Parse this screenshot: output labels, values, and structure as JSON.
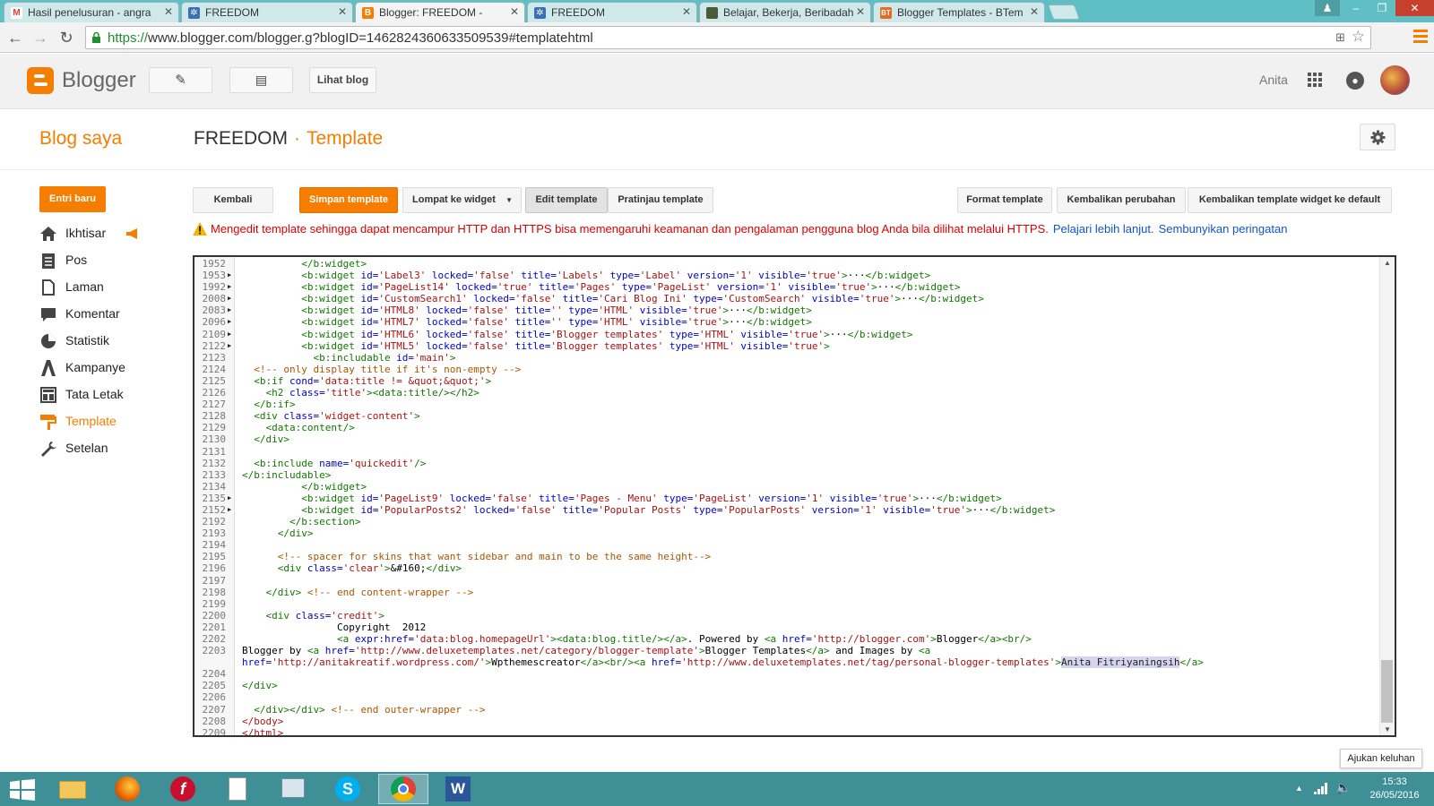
{
  "browser": {
    "tabs": [
      {
        "title": "Hasil penelusuran - angra",
        "icon": "gmail-icon",
        "active": false
      },
      {
        "title": "FREEDOM",
        "icon": "blog-favicon",
        "active": false
      },
      {
        "title": "Blogger: FREEDOM -",
        "icon": "blogger-icon",
        "active": true
      },
      {
        "title": "FREEDOM",
        "icon": "blog-favicon",
        "active": false
      },
      {
        "title": "Belajar, Bekerja, Beribadah",
        "icon": "page-icon",
        "active": false
      },
      {
        "title": "Blogger Templates - BTem",
        "icon": "btemplates-icon",
        "active": false
      }
    ],
    "url_secure": "https://",
    "url_rest": "www.blogger.com/blogger.g?blogID=1462824360633509539#templatehtml"
  },
  "header": {
    "brand": "Blogger",
    "view_blog": "Lihat blog",
    "username": "Anita"
  },
  "page": {
    "my_blogs": "Blog saya",
    "blog_name": "FREEDOM",
    "separator": "·",
    "section": "Template"
  },
  "sidebar": {
    "new_post": "Entri baru",
    "items": [
      {
        "label": "Ikhtisar",
        "icon": "home-icon"
      },
      {
        "label": "Pos",
        "icon": "posts-icon"
      },
      {
        "label": "Laman",
        "icon": "pages-icon"
      },
      {
        "label": "Komentar",
        "icon": "comment-icon"
      },
      {
        "label": "Statistik",
        "icon": "stats-icon"
      },
      {
        "label": "Kampanye",
        "icon": "campaign-icon"
      },
      {
        "label": "Tata Letak",
        "icon": "layout-icon"
      },
      {
        "label": "Template",
        "icon": "template-icon",
        "active": true
      },
      {
        "label": "Setelan",
        "icon": "wrench-icon"
      }
    ]
  },
  "toolbar": {
    "back": "Kembali",
    "save": "Simpan template",
    "jump": "Lompat ke widget",
    "edit": "Edit template",
    "preview": "Pratinjau template",
    "format": "Format template",
    "revert": "Kembalikan perubahan",
    "revert_widgets": "Kembalikan template widget ke default"
  },
  "warning": {
    "text": "Mengedit template sehingga dapat mencampur HTTP dan HTTPS bisa memengaruhi keamanan dan pengalaman pengguna blog Anda bila dilihat melalui HTTPS.",
    "learn_more": "Pelajari lebih lanjut.",
    "hide": "Sembunyikan peringatan"
  },
  "code_lines": [
    {
      "n": "1952",
      "a": false,
      "t": [
        [
          "tag",
          "          </b:widget>"
        ]
      ]
    },
    {
      "n": "1953",
      "a": true,
      "t": [
        [
          "tag",
          "          <b:widget "
        ],
        [
          "attr",
          "id="
        ],
        [
          "str",
          "'Label3'"
        ],
        [
          "attr",
          " locked="
        ],
        [
          "str",
          "'false'"
        ],
        [
          "attr",
          " title="
        ],
        [
          "str",
          "'Labels'"
        ],
        [
          "attr",
          " type="
        ],
        [
          "str",
          "'Label'"
        ],
        [
          "attr",
          " version="
        ],
        [
          "str",
          "'1'"
        ],
        [
          "attr",
          " visible="
        ],
        [
          "str",
          "'true'"
        ],
        [
          "tag",
          ">"
        ],
        [
          "plain",
          "···"
        ],
        [
          "tag",
          "</b:widget>"
        ]
      ]
    },
    {
      "n": "1992",
      "a": true,
      "t": [
        [
          "tag",
          "          <b:widget "
        ],
        [
          "attr",
          "id="
        ],
        [
          "str",
          "'PageList14'"
        ],
        [
          "attr",
          " locked="
        ],
        [
          "str",
          "'true'"
        ],
        [
          "attr",
          " title="
        ],
        [
          "str",
          "'Pages'"
        ],
        [
          "attr",
          " type="
        ],
        [
          "str",
          "'PageList'"
        ],
        [
          "attr",
          " version="
        ],
        [
          "str",
          "'1'"
        ],
        [
          "attr",
          " visible="
        ],
        [
          "str",
          "'true'"
        ],
        [
          "tag",
          ">"
        ],
        [
          "plain",
          "···"
        ],
        [
          "tag",
          "</b:widget>"
        ]
      ]
    },
    {
      "n": "2008",
      "a": true,
      "t": [
        [
          "tag",
          "          <b:widget "
        ],
        [
          "attr",
          "id="
        ],
        [
          "str",
          "'CustomSearch1'"
        ],
        [
          "attr",
          " locked="
        ],
        [
          "str",
          "'false'"
        ],
        [
          "attr",
          " title="
        ],
        [
          "str",
          "'Cari Blog Ini'"
        ],
        [
          "attr",
          " type="
        ],
        [
          "str",
          "'CustomSearch'"
        ],
        [
          "attr",
          " visible="
        ],
        [
          "str",
          "'true'"
        ],
        [
          "tag",
          ">"
        ],
        [
          "plain",
          "···"
        ],
        [
          "tag",
          "</b:widget>"
        ]
      ]
    },
    {
      "n": "2083",
      "a": true,
      "t": [
        [
          "tag",
          "          <b:widget "
        ],
        [
          "attr",
          "id="
        ],
        [
          "str",
          "'HTML8'"
        ],
        [
          "attr",
          " locked="
        ],
        [
          "str",
          "'false'"
        ],
        [
          "attr",
          " title="
        ],
        [
          "str",
          "''"
        ],
        [
          "attr",
          " type="
        ],
        [
          "str",
          "'HTML'"
        ],
        [
          "attr",
          " visible="
        ],
        [
          "str",
          "'true'"
        ],
        [
          "tag",
          ">"
        ],
        [
          "plain",
          "···"
        ],
        [
          "tag",
          "</b:widget>"
        ]
      ]
    },
    {
      "n": "2096",
      "a": true,
      "t": [
        [
          "tag",
          "          <b:widget "
        ],
        [
          "attr",
          "id="
        ],
        [
          "str",
          "'HTML7'"
        ],
        [
          "attr",
          " locked="
        ],
        [
          "str",
          "'false'"
        ],
        [
          "attr",
          " title="
        ],
        [
          "str",
          "''"
        ],
        [
          "attr",
          " type="
        ],
        [
          "str",
          "'HTML'"
        ],
        [
          "attr",
          " visible="
        ],
        [
          "str",
          "'true'"
        ],
        [
          "tag",
          ">"
        ],
        [
          "plain",
          "···"
        ],
        [
          "tag",
          "</b:widget>"
        ]
      ]
    },
    {
      "n": "2109",
      "a": true,
      "t": [
        [
          "tag",
          "          <b:widget "
        ],
        [
          "attr",
          "id="
        ],
        [
          "str",
          "'HTML6'"
        ],
        [
          "attr",
          " locked="
        ],
        [
          "str",
          "'false'"
        ],
        [
          "attr",
          " title="
        ],
        [
          "str",
          "'Blogger templates'"
        ],
        [
          "attr",
          " type="
        ],
        [
          "str",
          "'HTML'"
        ],
        [
          "attr",
          " visible="
        ],
        [
          "str",
          "'true'"
        ],
        [
          "tag",
          ">"
        ],
        [
          "plain",
          "···"
        ],
        [
          "tag",
          "</b:widget>"
        ]
      ]
    },
    {
      "n": "2122",
      "a": true,
      "t": [
        [
          "tag",
          "          <b:widget "
        ],
        [
          "attr",
          "id="
        ],
        [
          "str",
          "'HTML5'"
        ],
        [
          "attr",
          " locked="
        ],
        [
          "str",
          "'false'"
        ],
        [
          "attr",
          " title="
        ],
        [
          "str",
          "'Blogger templates'"
        ],
        [
          "attr",
          " type="
        ],
        [
          "str",
          "'HTML'"
        ],
        [
          "attr",
          " visible="
        ],
        [
          "str",
          "'true'"
        ],
        [
          "tag",
          ">"
        ]
      ]
    },
    {
      "n": "2123",
      "a": false,
      "t": [
        [
          "tag",
          "            <b:includable "
        ],
        [
          "attr",
          "id="
        ],
        [
          "str",
          "'main'"
        ],
        [
          "tag",
          ">"
        ]
      ]
    },
    {
      "n": "2124",
      "a": false,
      "t": [
        [
          "cmt",
          "  <!-- only display title if it's non-empty -->"
        ]
      ]
    },
    {
      "n": "2125",
      "a": false,
      "t": [
        [
          "tag",
          "  <b:if "
        ],
        [
          "attr",
          "cond="
        ],
        [
          "str",
          "'data:title != &quot;&quot;'"
        ],
        [
          "tag",
          ">"
        ]
      ]
    },
    {
      "n": "2126",
      "a": false,
      "t": [
        [
          "tag",
          "    <h2 "
        ],
        [
          "attr",
          "class="
        ],
        [
          "str",
          "'title'"
        ],
        [
          "tag",
          "><data:title/></h2>"
        ]
      ]
    },
    {
      "n": "2127",
      "a": false,
      "t": [
        [
          "tag",
          "  </b:if>"
        ]
      ]
    },
    {
      "n": "2128",
      "a": false,
      "t": [
        [
          "tag",
          "  <div "
        ],
        [
          "attr",
          "class="
        ],
        [
          "str",
          "'widget-content'"
        ],
        [
          "tag",
          ">"
        ]
      ]
    },
    {
      "n": "2129",
      "a": false,
      "t": [
        [
          "tag",
          "    <data:content/>"
        ]
      ]
    },
    {
      "n": "2130",
      "a": false,
      "t": [
        [
          "tag",
          "  </div>"
        ]
      ]
    },
    {
      "n": "2131",
      "a": false,
      "t": []
    },
    {
      "n": "2132",
      "a": false,
      "t": [
        [
          "tag",
          "  <b:include "
        ],
        [
          "attr",
          "name="
        ],
        [
          "str",
          "'quickedit'"
        ],
        [
          "tag",
          "/>"
        ]
      ]
    },
    {
      "n": "2133",
      "a": false,
      "t": [
        [
          "tag",
          "</b:includable>"
        ]
      ]
    },
    {
      "n": "2134",
      "a": false,
      "t": [
        [
          "tag",
          "          </b:widget>"
        ]
      ]
    },
    {
      "n": "2135",
      "a": true,
      "t": [
        [
          "tag",
          "          <b:widget "
        ],
        [
          "attr",
          "id="
        ],
        [
          "str",
          "'PageList9'"
        ],
        [
          "attr",
          " locked="
        ],
        [
          "str",
          "'false'"
        ],
        [
          "attr",
          " title="
        ],
        [
          "str",
          "'Pages - Menu'"
        ],
        [
          "attr",
          " type="
        ],
        [
          "str",
          "'PageList'"
        ],
        [
          "attr",
          " version="
        ],
        [
          "str",
          "'1'"
        ],
        [
          "attr",
          " visible="
        ],
        [
          "str",
          "'true'"
        ],
        [
          "tag",
          ">"
        ],
        [
          "plain",
          "···"
        ],
        [
          "tag",
          "</b:widget>"
        ]
      ]
    },
    {
      "n": "2152",
      "a": true,
      "t": [
        [
          "tag",
          "          <b:widget "
        ],
        [
          "attr",
          "id="
        ],
        [
          "str",
          "'PopularPosts2'"
        ],
        [
          "attr",
          " locked="
        ],
        [
          "str",
          "'false'"
        ],
        [
          "attr",
          " title="
        ],
        [
          "str",
          "'Popular Posts'"
        ],
        [
          "attr",
          " type="
        ],
        [
          "str",
          "'PopularPosts'"
        ],
        [
          "attr",
          " version="
        ],
        [
          "str",
          "'1'"
        ],
        [
          "attr",
          " visible="
        ],
        [
          "str",
          "'true'"
        ],
        [
          "tag",
          ">"
        ],
        [
          "plain",
          "···"
        ],
        [
          "tag",
          "</b:widget>"
        ]
      ]
    },
    {
      "n": "2192",
      "a": false,
      "t": [
        [
          "tag",
          "        </b:section>"
        ]
      ]
    },
    {
      "n": "2193",
      "a": false,
      "t": [
        [
          "tag",
          "      </div>"
        ]
      ]
    },
    {
      "n": "2194",
      "a": false,
      "t": []
    },
    {
      "n": "2195",
      "a": false,
      "t": [
        [
          "cmt",
          "      <!-- spacer for skins that want sidebar and main to be the same height-->"
        ]
      ]
    },
    {
      "n": "2196",
      "a": false,
      "t": [
        [
          "tag",
          "      <div "
        ],
        [
          "attr",
          "class="
        ],
        [
          "str",
          "'clear'"
        ],
        [
          "tag",
          ">"
        ],
        [
          "plain",
          "&#160;"
        ],
        [
          "tag",
          "</div>"
        ]
      ]
    },
    {
      "n": "2197",
      "a": false,
      "t": []
    },
    {
      "n": "2198",
      "a": false,
      "t": [
        [
          "tag",
          "    </div> "
        ],
        [
          "cmt",
          "<!-- end content-wrapper -->"
        ]
      ]
    },
    {
      "n": "2199",
      "a": false,
      "t": []
    },
    {
      "n": "2200",
      "a": false,
      "t": [
        [
          "tag",
          "    <div "
        ],
        [
          "attr",
          "class="
        ],
        [
          "str",
          "'credit'"
        ],
        [
          "tag",
          ">"
        ]
      ]
    },
    {
      "n": "2201",
      "a": false,
      "t": [
        [
          "plain",
          "                Copyright  2012"
        ]
      ]
    },
    {
      "n": "2202",
      "a": false,
      "t": [
        [
          "tag",
          "                <a "
        ],
        [
          "attr",
          "expr:href="
        ],
        [
          "str",
          "'data:blog.homepageUrl'"
        ],
        [
          "tag",
          "><data:blog.title/></a>"
        ],
        [
          "plain",
          ". Powered by "
        ],
        [
          "tag",
          "<a "
        ],
        [
          "attr",
          "href="
        ],
        [
          "str",
          "'http://blogger.com'"
        ],
        [
          "tag",
          ">"
        ],
        [
          "plain",
          "Blogger"
        ],
        [
          "tag",
          "</a><br/>"
        ]
      ]
    },
    {
      "n": "2203",
      "a": false,
      "t": [
        [
          "plain",
          "Blogger by "
        ],
        [
          "tag",
          "<a "
        ],
        [
          "attr",
          "href="
        ],
        [
          "str",
          "'http://www.deluxetemplates.net/category/blogger-template'"
        ],
        [
          "tag",
          ">"
        ],
        [
          "plain",
          "Blogger Templates"
        ],
        [
          "tag",
          "</a>"
        ],
        [
          "plain",
          " and Images by "
        ],
        [
          "tag",
          "<a"
        ]
      ]
    },
    {
      "n": "",
      "a": false,
      "t": [
        [
          "attr",
          "href="
        ],
        [
          "str",
          "'http://anitakreatif.wordpress.com/'"
        ],
        [
          "tag",
          ">"
        ],
        [
          "plain",
          "Wpthemescreator"
        ],
        [
          "tag",
          "</a><br/><a "
        ],
        [
          "attr",
          "href="
        ],
        [
          "str",
          "'http://www.deluxetemplates.net/tag/personal-blogger-templates'"
        ],
        [
          "tag",
          ">"
        ],
        [
          "hl",
          "Anita Fitriyaningsih"
        ],
        [
          "tag",
          "</a>"
        ]
      ]
    },
    {
      "n": "2204",
      "a": false,
      "t": []
    },
    {
      "n": "2205",
      "a": false,
      "t": [
        [
          "tag",
          "</div>"
        ]
      ]
    },
    {
      "n": "2206",
      "a": false,
      "t": []
    },
    {
      "n": "2207",
      "a": false,
      "t": [
        [
          "tag",
          "  </div></div> "
        ],
        [
          "cmt",
          "<!-- end outer-wrapper -->"
        ]
      ]
    },
    {
      "n": "2208",
      "a": false,
      "t": [
        [
          "str",
          "</body>"
        ]
      ]
    },
    {
      "n": "2209",
      "a": false,
      "t": [
        [
          "str",
          "</html>"
        ]
      ]
    }
  ],
  "feedback": "Ajukan keluhan",
  "taskbar": {
    "apps": [
      "start-icon",
      "explorer-icon",
      "firefox-icon",
      "flash-icon",
      "file-icon",
      "tool-icon",
      "skype-icon",
      "chrome-icon",
      "word-icon"
    ],
    "time": "15:33",
    "date": "26/05/2016"
  },
  "colors": {
    "accent": "#f57d00",
    "tabstrip": "#5fbfc4",
    "taskbar": "#3f8f96",
    "warning": "#dd0000",
    "link": "#1155cc"
  }
}
